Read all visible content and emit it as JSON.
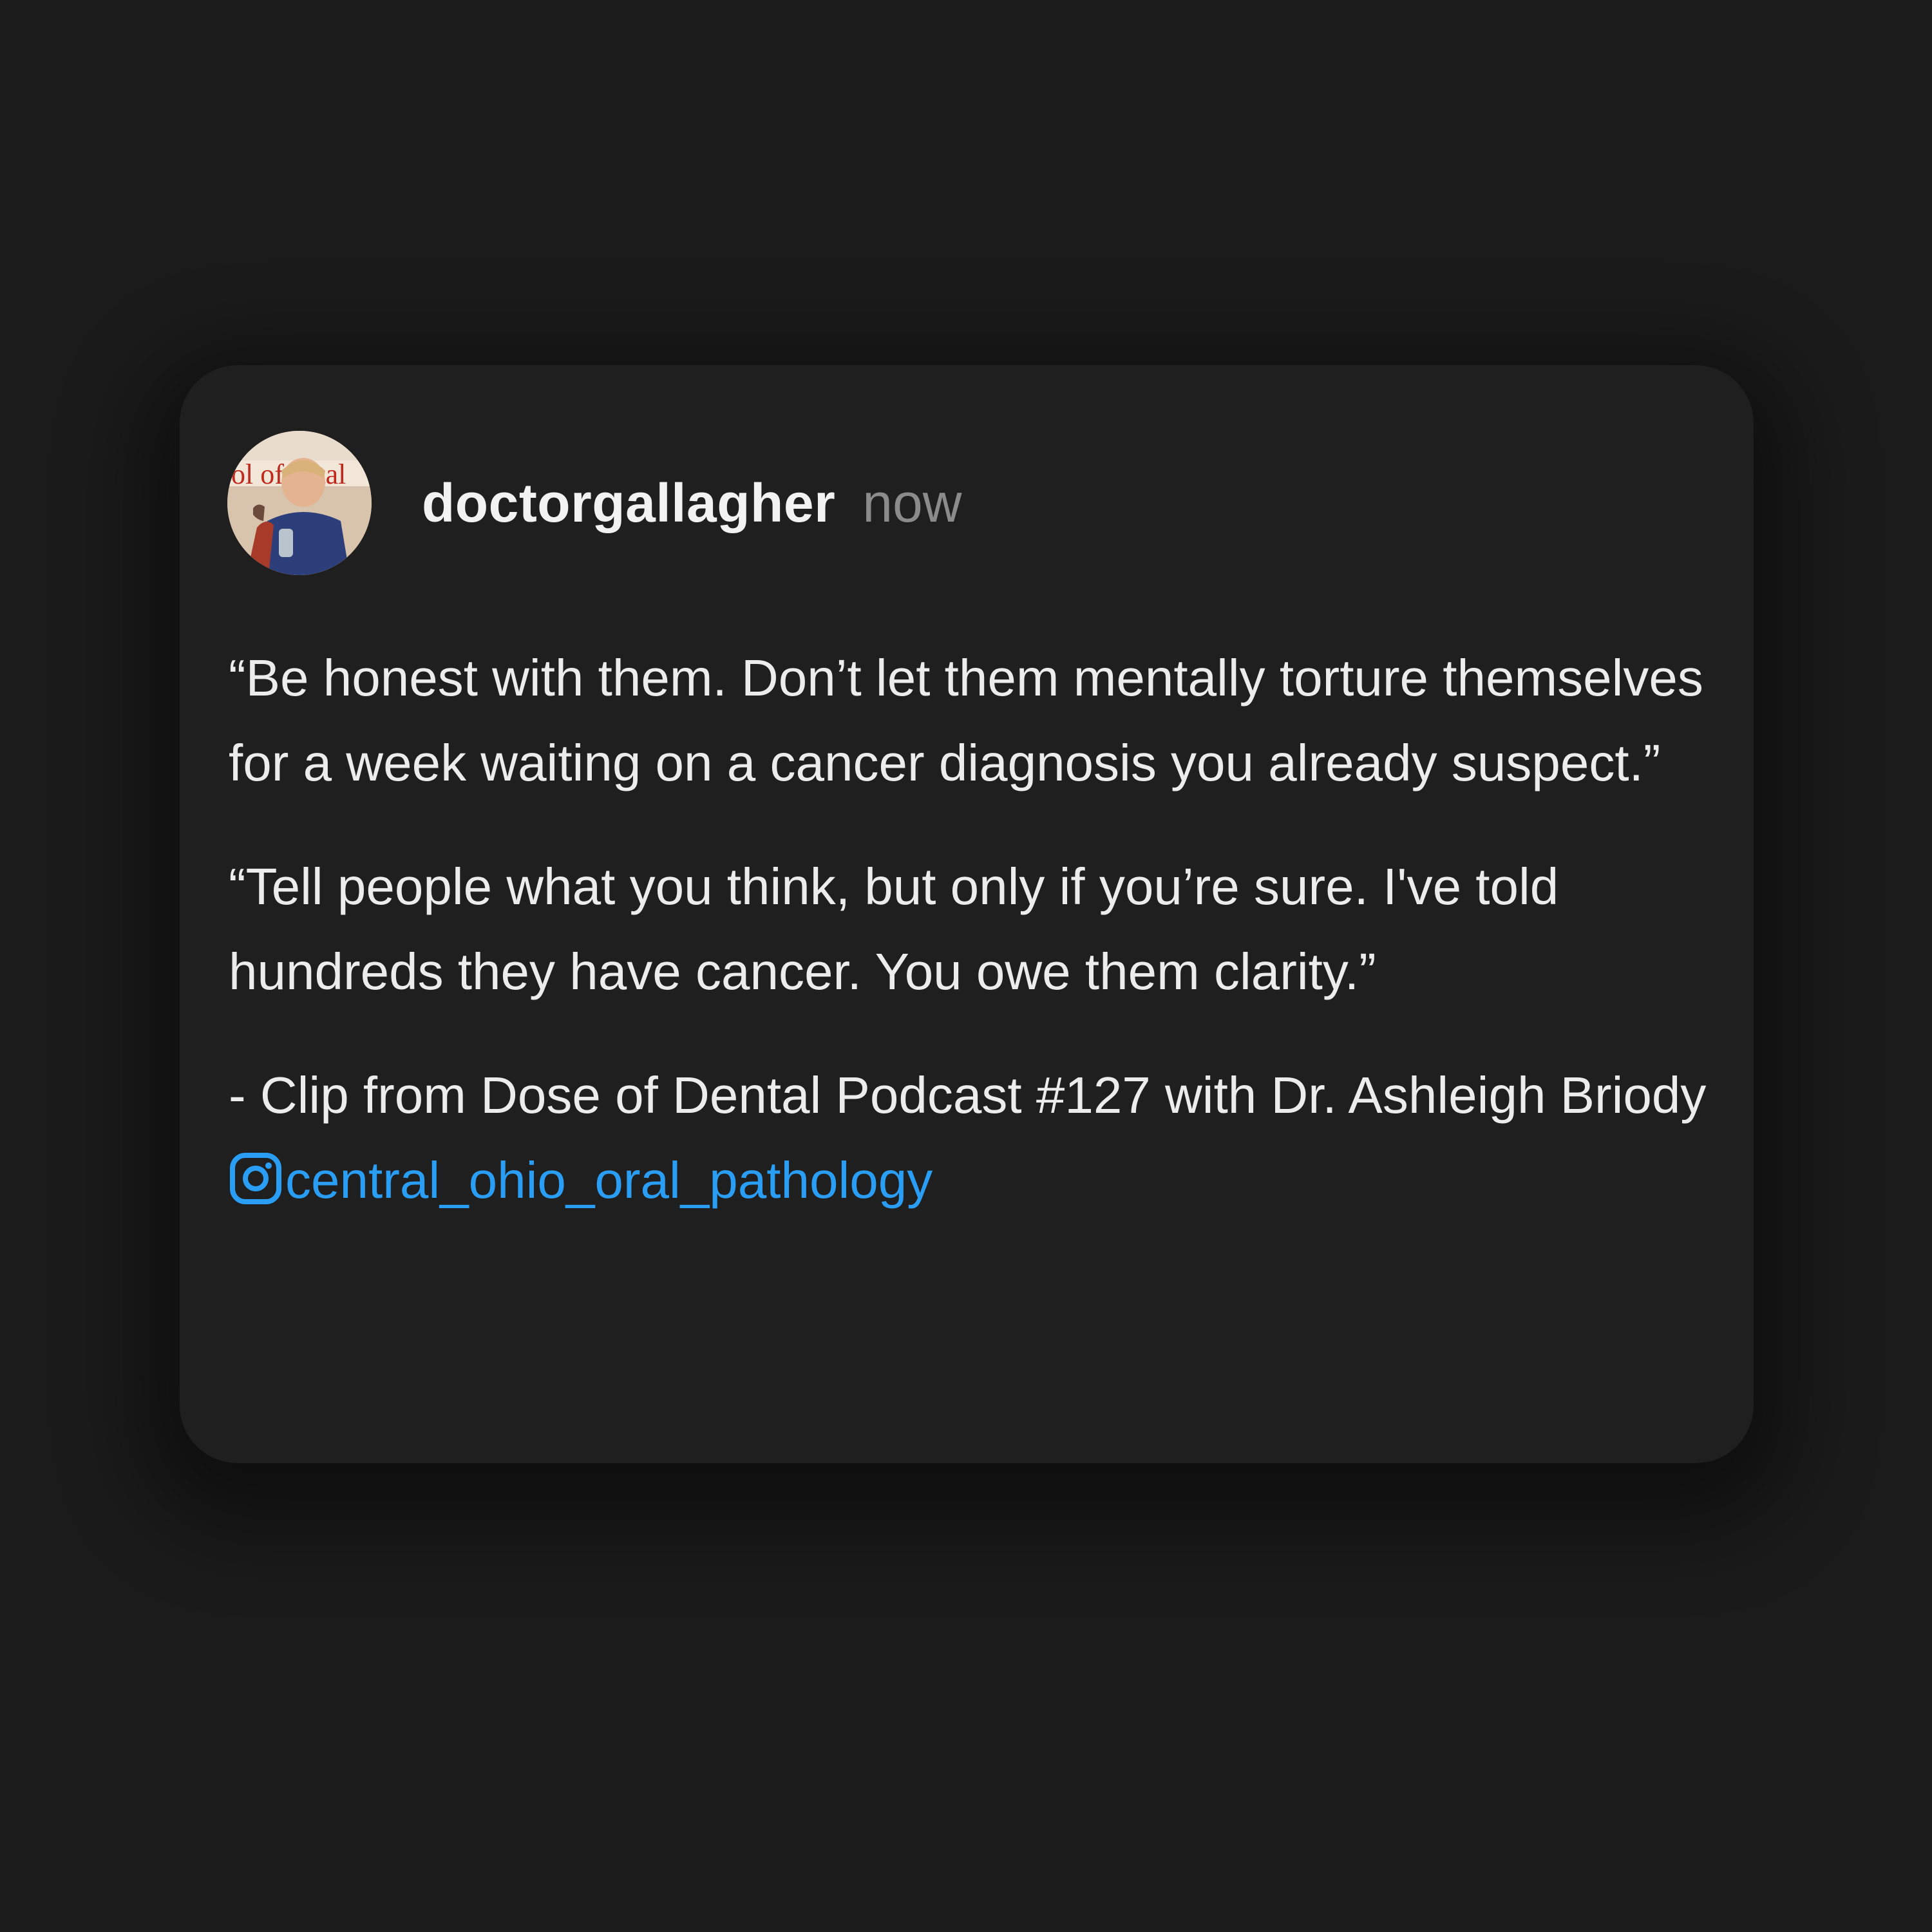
{
  "post": {
    "username": "doctorgallagher",
    "timestamp": "now",
    "paragraphs": [
      "“Be honest with them. Don’t let them mentally torture themselves for a week waiting on a cancer diagnosis you already suspect.”",
      "“Tell people what you think, but only if you’re sure. I've told hundreds they have cancer. You owe them clarity.”"
    ],
    "credit_text": "- Clip from Dose of Dental Podcast #127 with Dr. Ashleigh Briody ",
    "mention_handle": "central_ohio_oral_pathology",
    "avatar_icon": "profile-photo",
    "mention_icon": "instagram-icon"
  },
  "colors": {
    "background": "#1b1b1b",
    "card": "#1f1f1f",
    "text": "#ececec",
    "muted": "#8b8b8b",
    "link": "#2a9df4"
  }
}
